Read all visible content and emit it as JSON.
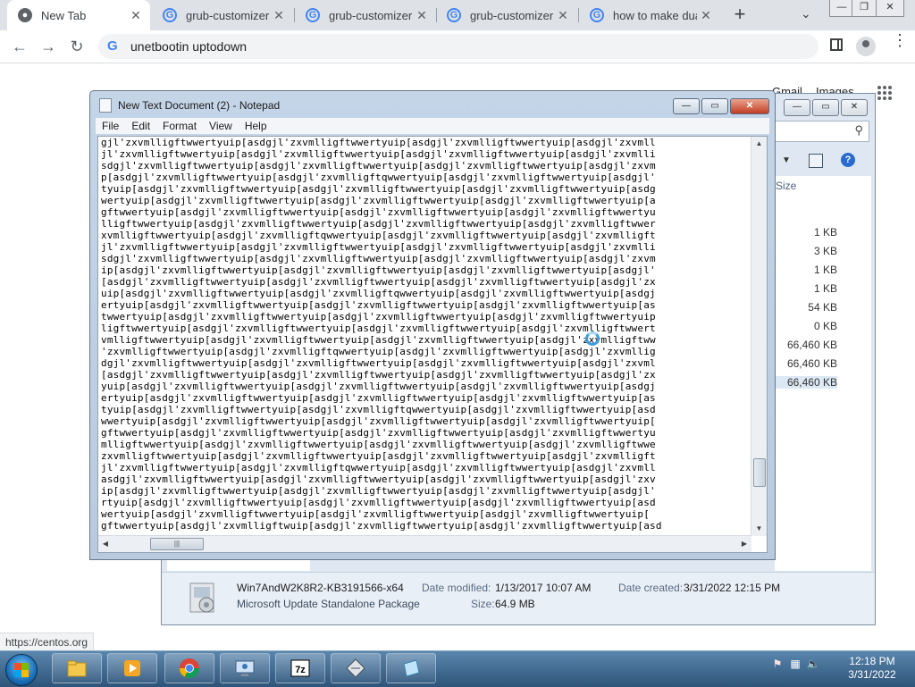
{
  "browser": {
    "tabs": [
      {
        "title": "New Tab",
        "active": true
      },
      {
        "title": "grub-customizer d",
        "active": false
      },
      {
        "title": "grub-customizer d",
        "active": false
      },
      {
        "title": "grub-customizer d",
        "active": false
      },
      {
        "title": "how to make dual",
        "active": false
      }
    ],
    "new_tab": "+",
    "address": "unetbootin uptodown",
    "status_url": "https://centos.org"
  },
  "google_page": {
    "gmail": "Gmail",
    "images": "Images"
  },
  "notepad": {
    "title": "New Text Document (2) - Notepad",
    "menu": [
      "File",
      "Edit",
      "Format",
      "View",
      "Help"
    ],
    "lines": [
      "gjl'zxvmlligftwwertyuip[asdgjl'zxvmlligftwwertyuip[asdgjl'zxvmlligftwwertyuip[asdgjl'zxvmll",
      "jl'zxvmlligftwwertyuip[asdgjl'zxvmlligftwwertyuip[asdgjl'zxvmlligftwwertyuip[asdgjl'zxvmlli",
      "sdgjl'zxvmlligftwwertyuip[asdgjl'zxvmlligftwwertyuip[asdgjl'zxvmlligftwwertyuip[asdgjl'zxvm",
      "p[asdgjl'zxvmlligftwwertyuip[asdgjl'zxvmlligftqwwertyuip[asdgjl'zxvmlligftwwertyuip[asdgjl'",
      "tyuip[asdgjl'zxvmlligftwwertyuip[asdgjl'zxvmlligftwwertyuip[asdgjl'zxvmlligftwwertyuip[asdg",
      "wertyuip[asdgjl'zxvmlligftwwertyuip[asdgjl'zxvmlligftwwertyuip[asdgjl'zxvmlligftwwertyuip[a",
      "gftwwertyuip[asdgjl'zxvmlligftwwertyuip[asdgjl'zxvmlligftwwertyuip[asdgjl'zxvmlligftwwertyu",
      "lligftwwertyuip[asdgjl'zxvmlligftwwertyuip[asdgjl'zxvmlligftwwertyuip[asdgjl'zxvmlligftwwer",
      "xvmlligftwwertyuip[asdgjl'zxvmlligftqwwertyuip[asdgjl'zxvmlligftwwertyuip[asdgjl'zxvmlligft",
      "jl'zxvmlligftwwertyuip[asdgjl'zxvmlligftwwertyuip[asdgjl'zxvmlligftwwertyuip[asdgjl'zxvmlli",
      "sdgjl'zxvmlligftwwertyuip[asdgjl'zxvmlligftwwertyuip[asdgjl'zxvmlligftwwertyuip[asdgjl'zxvm",
      "ip[asdgjl'zxvmlligftwwertyuip[asdgjl'zxvmlligftwwertyuip[asdgjl'zxvmlligftwwertyuip[asdgjl'",
      "[asdgjl'zxvmlligftwwertyuip[asdgjl'zxvmlligftwwertyuip[asdgjl'zxvmlligftwwertyuip[asdgjl'zx",
      "uip[asdgjl'zxvmlligftwwertyuip[asdgjl'zxvmlligftqwwertyuip[asdgjl'zxvmlligftwwertyuip[asdgj",
      "ertyuip[asdgjl'zxvmlligftwwertyuip[asdgjl'zxvmlligftwwertyuip[asdgjl'zxvmlligftwwertyuip[as",
      "twwertyuip[asdgjl'zxvmlligftwwertyuip[asdgjl'zxvmlligftwwertyuip[asdgjl'zxvmlligftwwertyuip",
      "ligftwwertyuip[asdgjl'zxvmlligftwwertyuip[asdgjl'zxvmlligftwwertyuip[asdgjl'zxvmlligftwwert",
      "vmlligftwwertyuip[asdgjl'zxvmlligftwwertyuip[asdgjl'zxvmlligftwwertyuip[asdgjl'zxvmlligftww",
      "'zxvmlligftwwertyuip[asdgjl'zxvmlligftqwwertyuip[asdgjl'zxvmlligftwwertyuip[asdgjl'zxvmllig",
      "dgjl'zxvmlligftwwertyuip[asdgjl'zxvmlligftwwertyuip[asdgjl'zxvmlligftwwertyuip[asdgjl'zxvml",
      "[asdgjl'zxvmlligftwwertyuip[asdgjl'zxvmlligftwwertyuip[asdgjl'zxvmlligftwwertyuip[asdgjl'zx",
      "yuip[asdgjl'zxvmlligftwwertyuip[asdgjl'zxvmlligftwwertyuip[asdgjl'zxvmlligftwwertyuip[asdgj",
      "ertyuip[asdgjl'zxvmlligftwwertyuip[asdgjl'zxvmlligftwwertyuip[asdgjl'zxvmlligftwwertyuip[as",
      "tyuip[asdgjl'zxvmlligftwwertyuip[asdgjl'zxvmlligftqwwertyuip[asdgjl'zxvmlligftwwertyuip[asd",
      "wwertyuip[asdgjl'zxvmlligftwwertyuip[asdgjl'zxvmlligftwwertyuip[asdgjl'zxvmlligftwwertyuip[",
      "gftwwertyuip[asdgjl'zxvmlligftwwertyuip[asdgjl'zxvmlligftwwertyuip[asdgjl'zxvmlligftwwertyu",
      "mlligftwwertyuip[asdgjl'zxvmlligftwwertyuip[asdgjl'zxvmlligftwwertyuip[asdgjl'zxvmlligftwwe",
      "zxvmlligftwwertyuip[asdgjl'zxvmlligftwwertyuip[asdgjl'zxvmlligftwwertyuip[asdgjl'zxvmlligft",
      "jl'zxvmlligftwwertyuip[asdgjl'zxvmlligftqwwertyuip[asdgjl'zxvmlligftwwertyuip[asdgjl'zxvmll",
      "asdgjl'zxvmlligftwwertyuip[asdgjl'zxvmlligftwwertyuip[asdgjl'zxvmlligftwwertyuip[asdgjl'zxv",
      "ip[asdgjl'zxvmlligftwwertyuip[asdgjl'zxvmlligftwwertyuip[asdgjl'zxvmlligftwwertyuip[asdgjl'",
      "rtyuip[asdgjl'zxvmlligftwwertyuip[asdgjl'zxvmlligftwwertyuip[asdgjl'zxvmlligftwwertyuip[asd",
      "wertyuip[asdgjl'zxvmlligftwwertyuip[asdgjl'zxvmlligftwwertyuip[asdgjl'zxvmlligftwwertyuip[",
      "gftwwertyuip[asdgjl'zxvmlligftwuip[asdgjl'zxvmlligftwwertyuip[asdgjl'zxvmlligftwwertyuip[asd"
    ]
  },
  "explorer": {
    "column_size": "Size",
    "sizes": [
      "1 KB",
      "3 KB",
      "1 KB",
      "1 KB",
      "54 KB",
      "0 KB",
      "66,460 KB",
      "66,460 KB",
      "66,460 KB"
    ],
    "selected_index": 8,
    "details": {
      "name": "Win7AndW2K8R2-KB3191566-x64",
      "type": "Microsoft Update Standalone Package",
      "modified_label": "Date modified:",
      "modified_value": "1/13/2017 10:07 AM",
      "created_label": "Date created:",
      "created_value": "3/31/2022 12:15 PM",
      "size_label": "Size:",
      "size_value": "64.9 MB"
    }
  },
  "taskbar": {
    "time": "12:18 PM",
    "date": "3/31/2022",
    "apps": [
      "explorer",
      "media-player",
      "chrome",
      "remote-desktop",
      "7zip",
      "disk-image",
      "notepad"
    ]
  },
  "colors": {
    "chrome_frame": "#dee1e6",
    "taskbar": "#2e5479",
    "notepad_frame": "#b9cadf"
  }
}
